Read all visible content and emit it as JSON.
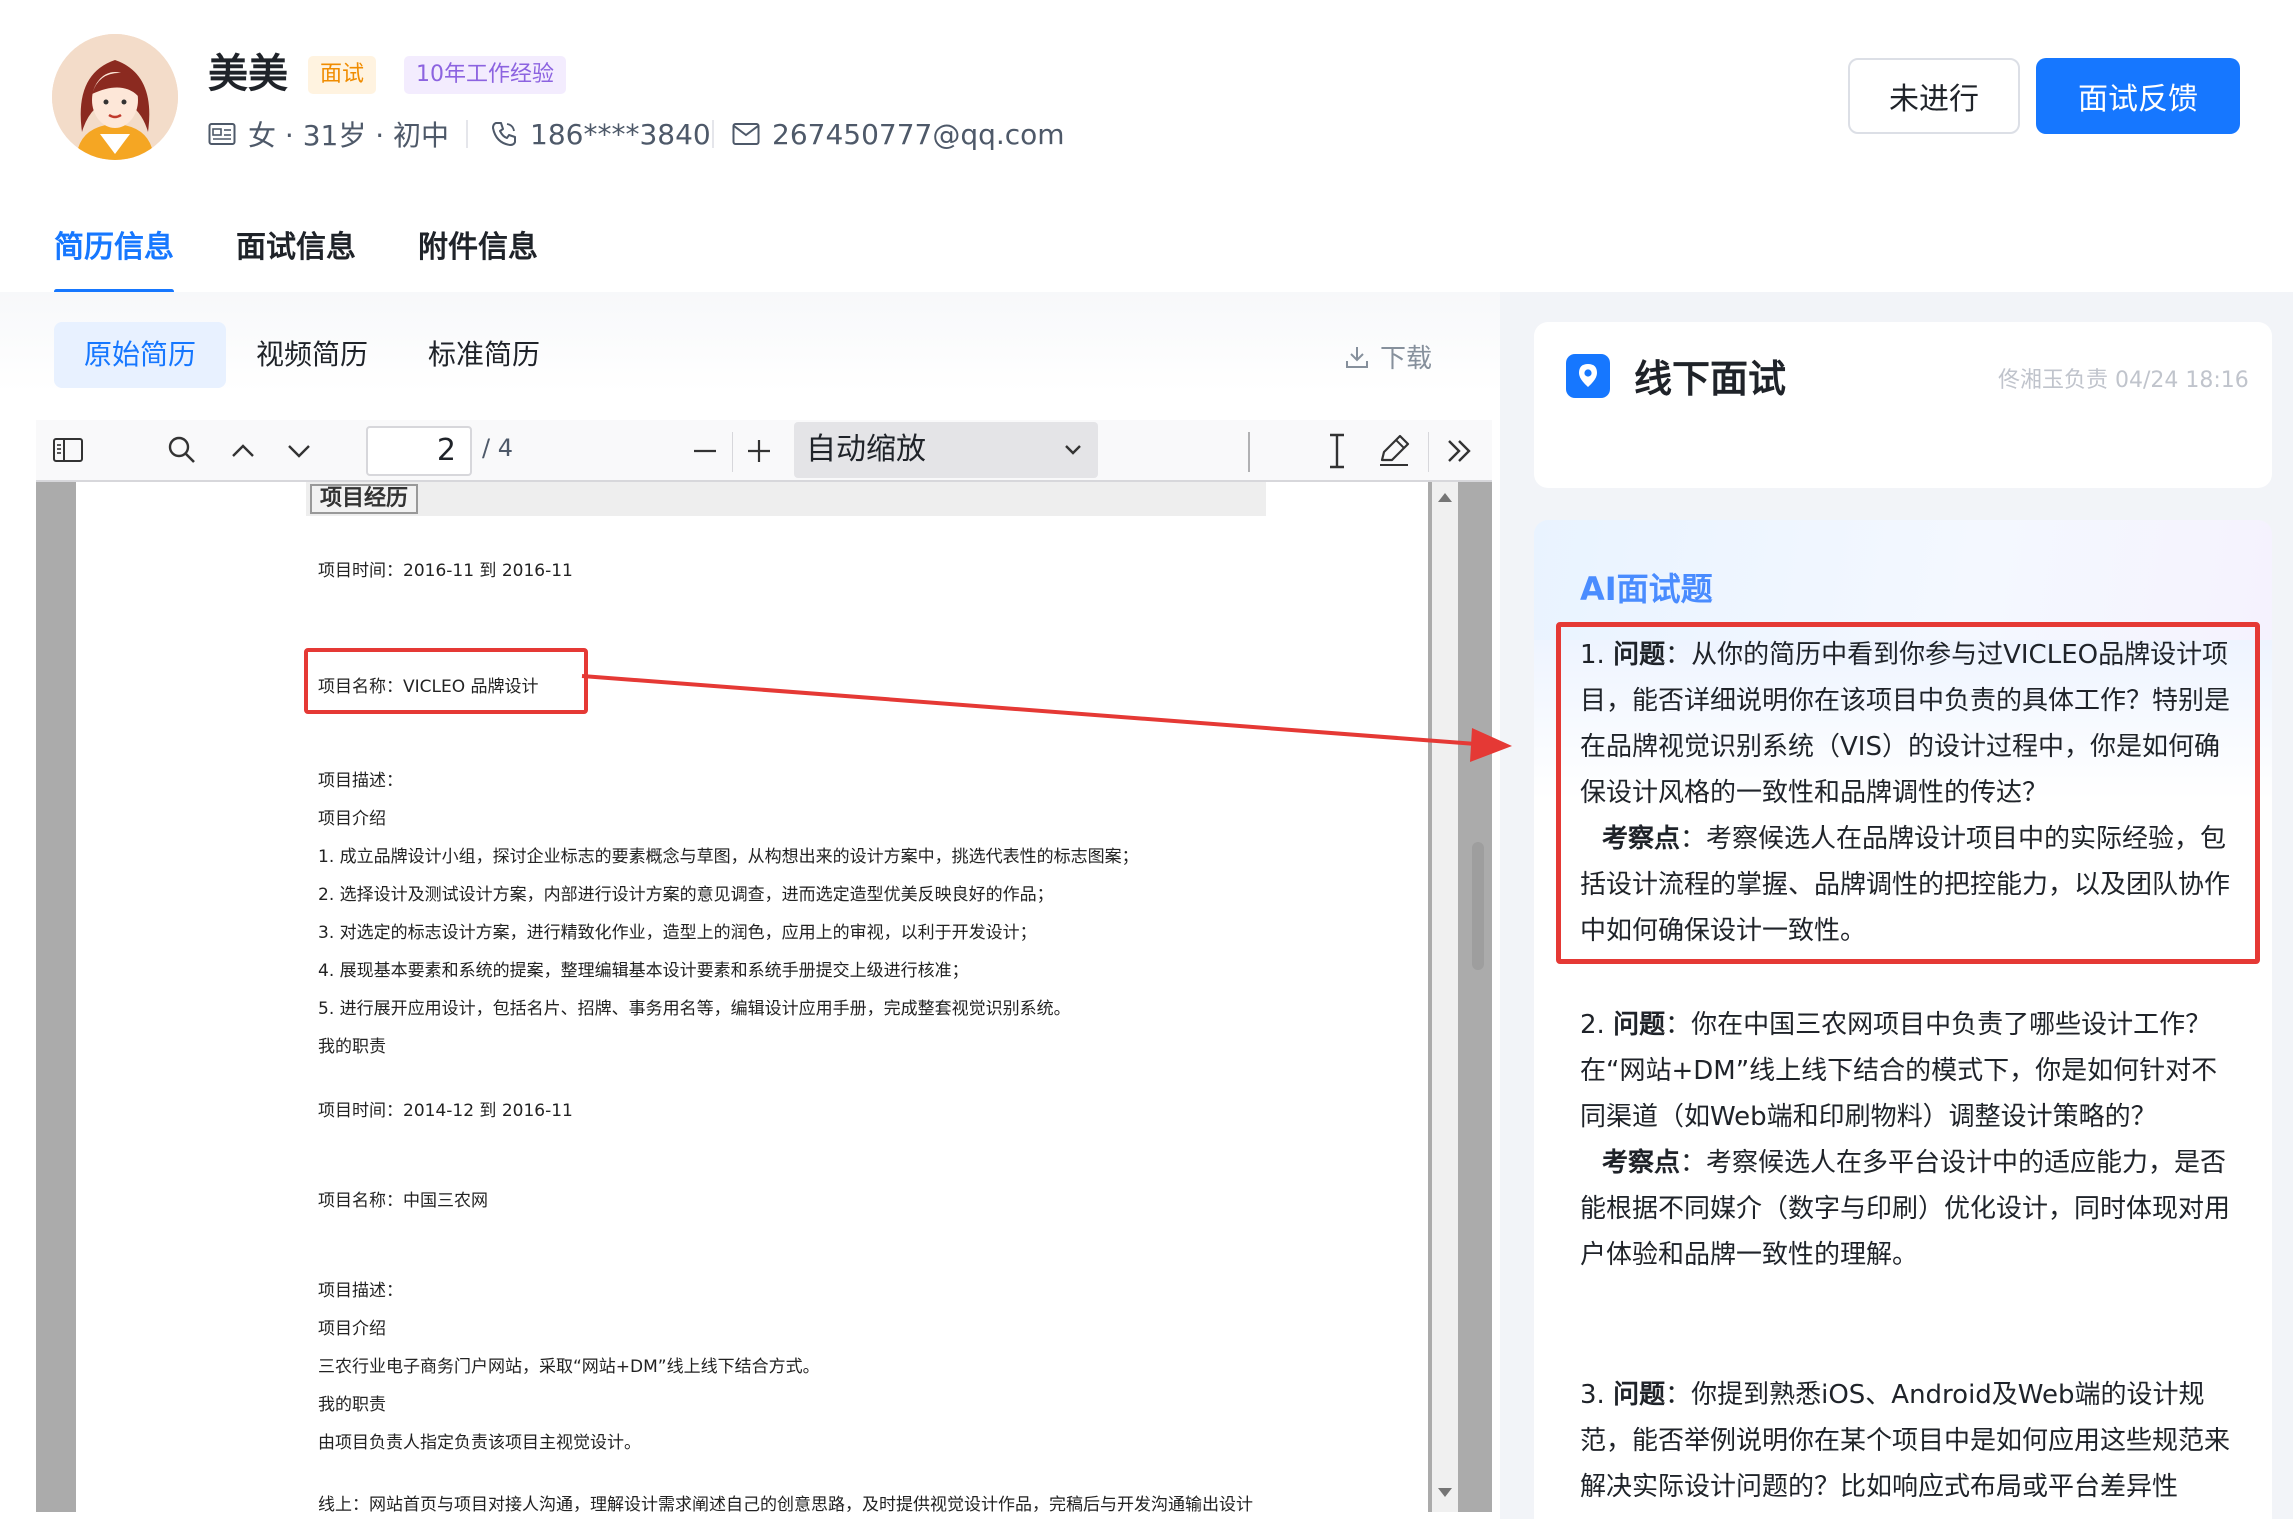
{
  "candidate": {
    "name": "美美",
    "stage_tag": "面试",
    "experience_tag": "10年工作经验",
    "profile": "女 · 31岁 · 初中",
    "phone": "186****3840",
    "email": "267450777@qq.com"
  },
  "actions": {
    "status_label": "未进行",
    "feedback_label": "面试反馈"
  },
  "main_tabs": [
    {
      "label": "简历信息",
      "active": true
    },
    {
      "label": "面试信息",
      "active": false
    },
    {
      "label": "附件信息",
      "active": false
    }
  ],
  "resume_tabs": [
    {
      "label": "原始简历",
      "active": true
    },
    {
      "label": "视频简历",
      "active": false
    },
    {
      "label": "标准简历",
      "active": false
    }
  ],
  "download_label": "下载",
  "pdf_viewer": {
    "current_page": "2",
    "total_pages": "/ 4",
    "zoom": "自动缩放"
  },
  "resume_doc": {
    "heading": "项目经历",
    "lines": [
      "项目时间：2016-11 到 2016-11",
      "项目名称：VICLEO 品牌设计",
      "项目描述：",
      "项目介绍",
      "1. 成立品牌设计小组，探讨企业标志的要素概念与草图，从构想出来的设计方案中，挑选代表性的标志图案；",
      "2. 选择设计及测试设计方案，内部进行设计方案的意见调查，进而选定造型优美反映良好的作品；",
      "3. 对选定的标志设计方案，进行精致化作业，造型上的润色，应用上的审视，以利于开发设计；",
      "4. 展现基本要素和系统的提案，整理编辑基本设计要素和系统手册提交上级进行核准；",
      "5. 进行展开应用设计，包括名片、招牌、事务用名等，编辑设计应用手册，完成整套视觉识别系统。",
      "我的职责",
      "项目时间：2014-12 到 2016-11",
      "项目名称：中国三农网",
      "项目描述：",
      "项目介绍",
      "三农行业电子商务门户网站，采取“网站+DM”线上线下结合方式。",
      "我的职责",
      "由项目负责人指定负责该项目主视觉设计。",
      "线上：网站首页与项目对接人沟通，理解设计需求阐述自己的创意思路，及时提供视觉设计作品，完稿后与开发沟通输出设计"
    ]
  },
  "interview": {
    "title": "线下面试",
    "meta": "佟湘玉负责 04/24 18:16"
  },
  "ai_questions": {
    "title": "AI面试题",
    "items": [
      {
        "prefix": "1. ",
        "question_label": "问题",
        "question": "：从你的简历中看到你参与过VICLEO品牌设计项目，能否详细说明你在该项目中负责的具体工作？特别是在品牌视觉识别系统（VIS）的设计过程中，你是如何确保设计风格的一致性和品牌调性的传达？",
        "note_label": "考察点",
        "note": "：考察候选人在品牌设计项目中的实际经验，包括设计流程的掌握、品牌调性的把控能力，以及团队协作中如何确保设计一致性。"
      },
      {
        "prefix": "2. ",
        "question_label": "问题",
        "question": "：你在中国三农网项目中负责了哪些设计工作？在“网站+DM”线上线下结合的模式下，你是如何针对不同渠道（如Web端和印刷物料）调整设计策略的？",
        "note_label": "考察点",
        "note": "：考察候选人在多平台设计中的适应能力，是否能根据不同媒介（数字与印刷）优化设计，同时体现对用户体验和品牌一致性的理解。"
      },
      {
        "prefix": "3. ",
        "question_label": "问题",
        "question": "：你提到熟悉iOS、Android及Web端的设计规范，能否举例说明你在某个项目中是如何应用这些规范来解决实际设计问题的？比如响应式布局或平台差异性"
      }
    ]
  },
  "colors": {
    "primary": "#1677ff",
    "highlight_red": "#e53935",
    "tag_orange": "#f08c00",
    "tag_purple": "#8c63e0"
  }
}
